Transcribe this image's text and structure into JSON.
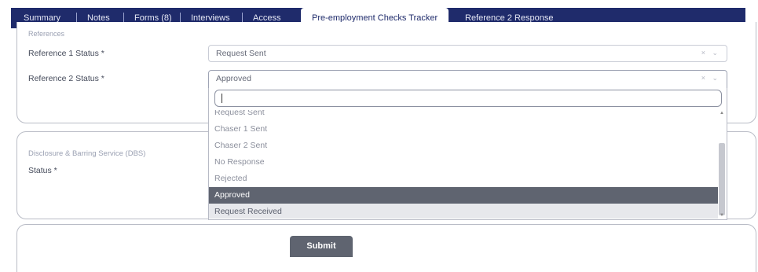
{
  "tabs": [
    {
      "label": "Summary"
    },
    {
      "label": "Notes"
    },
    {
      "label": "Forms (8)"
    },
    {
      "label": "Interviews"
    },
    {
      "label": "Access"
    },
    {
      "label": "Pre-employment Checks Tracker",
      "active": true
    },
    {
      "label": "Reference 2 Response"
    }
  ],
  "references": {
    "section_title": "References",
    "ref1_label": "Reference 1 Status *",
    "ref1_value": "Request Sent",
    "ref2_label": "Reference 2 Status *",
    "ref2_value": "Approved",
    "select_controls": "× ⌄"
  },
  "dropdown": {
    "search_value": "",
    "options": [
      "Request Sent",
      "Chaser 1 Sent",
      "Chaser 2 Sent",
      "No Response",
      "Rejected",
      "Approved",
      "Request Received"
    ],
    "selected": "Approved",
    "hovered": "Request Received"
  },
  "dbs": {
    "section_title": "Disclosure & Barring Service (DBS)",
    "status_label": "Status *"
  },
  "submit_label": "Submit",
  "colors": {
    "tab_bar": "#1f2b6b",
    "selected_option": "#5f6470",
    "submit": "#5f6470"
  }
}
